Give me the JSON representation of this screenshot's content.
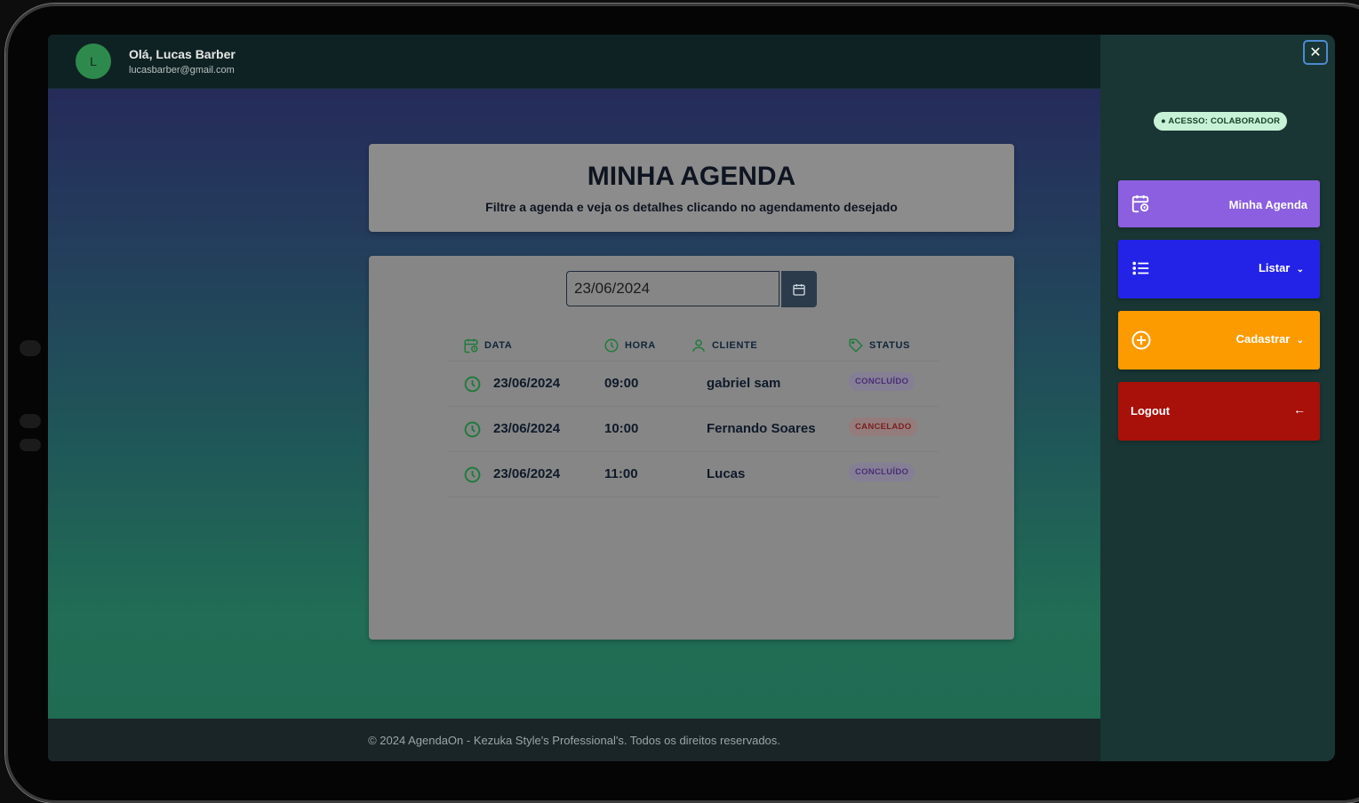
{
  "user": {
    "avatar_initial": "L",
    "greeting": "Olá,  Lucas Barber",
    "email": "lucasbarber@gmail.com"
  },
  "agenda": {
    "title": "MINHA AGENDA",
    "subtitle": "Filtre a agenda e veja os detalhes clicando no agendamento desejado",
    "date_value": "23/06/2024",
    "columns": [
      "DATA",
      "HORA",
      "CLIENTE",
      "STATUS"
    ],
    "rows": [
      {
        "date": "23/06/2024",
        "time": "09:00",
        "client": "gabriel sam",
        "status": "CONCLUÍDO"
      },
      {
        "date": "23/06/2024",
        "time": "10:00",
        "client": "Fernando Soares",
        "status": "CANCELADO"
      },
      {
        "date": "23/06/2024",
        "time": "11:00",
        "client": "Lucas",
        "status": "CONCLUÍDO"
      }
    ]
  },
  "footer": {
    "text": "© 2024 AgendaOn - Kezuka Style's Professional's. Todos os direitos reservados."
  },
  "sidebar": {
    "close_symbol": "✕",
    "access_badge": "● ACESSO: COLABORADOR",
    "items": [
      {
        "label": "Minha Agenda",
        "icon": "calendar-clock-icon",
        "color": "#8b5fe0"
      },
      {
        "label": "Listar",
        "icon": "list-icon",
        "color": "#2323e8"
      },
      {
        "label": "Cadastrar",
        "icon": "plus-circle-icon",
        "color": "#fb9b00"
      },
      {
        "label": "Logout",
        "icon": "arrow-left-icon",
        "color": "#a8100a"
      }
    ]
  },
  "colors": {
    "accent_green": "#1f7a3c",
    "done_badge": "#4a2e74",
    "cancel_badge": "#7a1e1e"
  }
}
